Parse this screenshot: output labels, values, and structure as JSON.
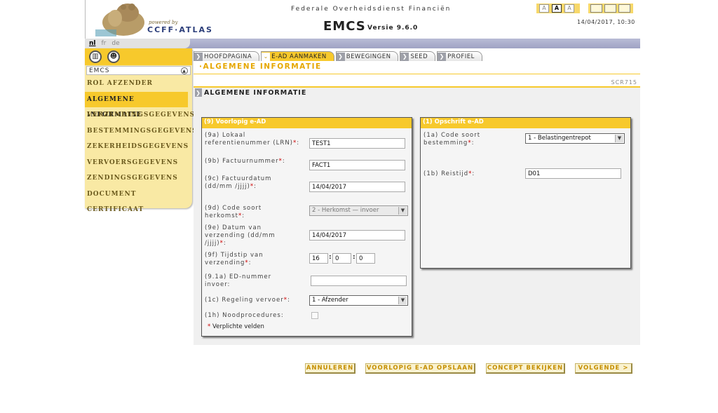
{
  "header": {
    "powered_by": "powered by",
    "brand": "CCFF·ATLAS",
    "agency": "Federale Overheidsdienst Financiën",
    "app_title": "EMCS",
    "app_version": "Versie 9.6.0",
    "datetime": "14/04/2017, 10:30",
    "font_size_buttons": [
      "A",
      "A",
      "A"
    ]
  },
  "languages": [
    "nl",
    "fr",
    "de"
  ],
  "sidebar": {
    "title": "EMCS",
    "items": [
      {
        "label": "ROL AFZENDER"
      },
      {
        "label": "ALGEMENE INFORMATIE"
      },
      {
        "label": "VERZENDINGSGEGEVENS"
      },
      {
        "label": "BESTEMMINGSGEGEVENS"
      },
      {
        "label": "ZEKERHEIDSGEGEVENS"
      },
      {
        "label": "VERVOERSGEGEVENS"
      },
      {
        "label": "ZENDINGSGEGEVENS"
      },
      {
        "label": "DOCUMENT CERTIFICAAT"
      }
    ]
  },
  "tabs": [
    {
      "label": "HOOFDPAGINA"
    },
    {
      "label": "E-AD AANMAKEN"
    },
    {
      "label": "BEWEGINGEN"
    },
    {
      "label": "SEED"
    },
    {
      "label": "PROFIEL"
    }
  ],
  "page": {
    "heading": "·ALGEMENE INFORMATIE",
    "screen_code": "SCR715",
    "section": "ALGEMENE INFORMATIE"
  },
  "left_panel": {
    "title": "(9) Voorlopig e-AD",
    "lrn_label": "(9a) Lokaal referentienummer (LRN)",
    "lrn_value": "TEST1",
    "invoice_label": "(9b) Factuurnummer",
    "invoice_value": "FACT1",
    "invoice_date_label": "(9c) Factuurdatum (dd/mm /jjjj)",
    "invoice_date_value": "14/04/2017",
    "origin_code_label": "(9d) Code soort herkomst",
    "origin_code_value": "2 - Herkomst — invoer",
    "dispatch_date_label": "(9e) Datum van verzending (dd/mm /jjjj)",
    "dispatch_date_value": "14/04/2017",
    "dispatch_time_label": "(9f) Tijdstip van verzending",
    "dispatch_time_hh": "16",
    "dispatch_time_mm": "0",
    "dispatch_time_ss": "0",
    "ed_number_label": "(9.1a) ED-nummer invoer:",
    "ed_number_value": "",
    "transport_label": "(1c) Regeling vervoer",
    "transport_value": "1 - Afzender",
    "emergency_label": "(1h) Noodprocedures:",
    "required_legend": "Verplichte velden"
  },
  "right_panel": {
    "title": "(1) Opschrift e-AD",
    "destination_code_label": "(1a) Code soort bestemming",
    "destination_code_value": "1 - Belastingentrepot",
    "journey_time_label": "(1b) Reistijd",
    "journey_time_value": "D01"
  },
  "actions": {
    "cancel": "ANNULEREN",
    "save_draft": "VOORLOPIG E-AD OPSLAAN",
    "view_draft": "CONCEPT BEKIJKEN",
    "next": "VOLGENDE >"
  }
}
